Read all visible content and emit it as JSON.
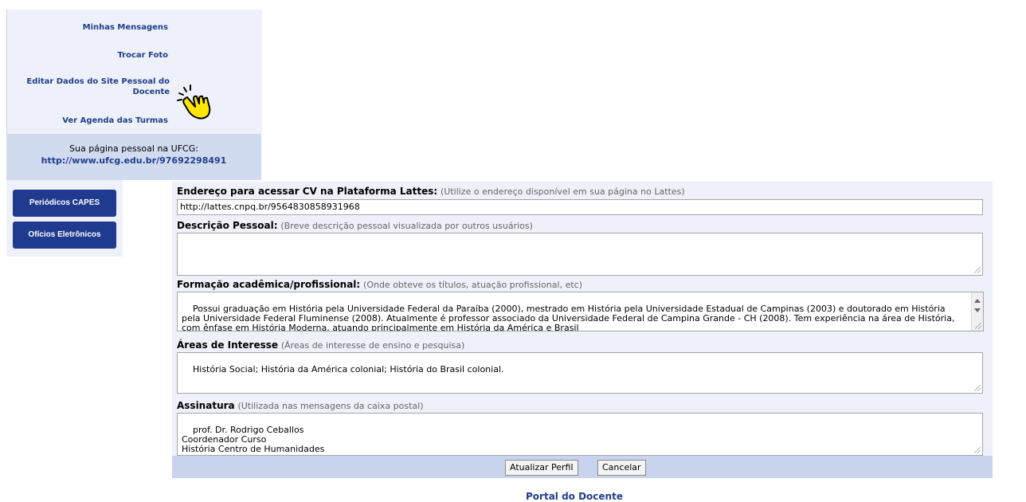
{
  "sidebar": {
    "menu": [
      {
        "label": "Minhas Mensagens"
      },
      {
        "label": "Trocar Foto"
      },
      {
        "label": "Editar Dados do Site Pessoal do Docente"
      },
      {
        "label": "Ver Agenda das Turmas"
      }
    ],
    "personal_page_label": "Sua página pessoal na UFCG:",
    "personal_page_url": "http://www.ufcg.edu.br/97692298491",
    "buttons": [
      {
        "label": "Periódicos CAPES"
      },
      {
        "label": "Ofícios Eletrônicos"
      }
    ],
    "pointer_icon": "pointing-hand-icon"
  },
  "form": {
    "lattes": {
      "label": "Endereço para acessar CV na Plataforma Lattes:",
      "hint": "(Utilize o endereço disponível em sua página no Lattes)",
      "value": "http://lattes.cnpq.br/9564830858931968"
    },
    "descricao": {
      "label": "Descrição Pessoal:",
      "hint": "(Breve descrição pessoal visualizada por outros usuários)",
      "value": ""
    },
    "formacao": {
      "label": "Formação acadêmica/profissional:",
      "hint": "(Onde obteve os títulos, atuação profissional, etc)",
      "value": "Possui graduação em História pela Universidade Federal da Paraíba (2000), mestrado em História pela Universidade Estadual de Campinas (2003) e doutorado em História pela Universidade Federal Fluminense (2008). Atualmente é professor associado da Universidade Federal de Campina Grande - CH (2008). Tem experiência na área de História, com ênfase em História Moderna, atuando principalmente em História da América e Brasil"
    },
    "areas": {
      "label": "Áreas de Interesse",
      "hint": "(Áreas de interesse de ensino e pesquisa)",
      "value": "História Social; História da América colonial; História do Brasil colonial."
    },
    "assinatura": {
      "label": "Assinatura",
      "hint": "(Utilizada nas mensagens da caixa postal)",
      "value": "prof. Dr. Rodrigo Ceballos\nCoordenador Curso\nHistória Centro de Humanidades"
    },
    "update_button": "Atualizar Perfil",
    "cancel_button": "Cancelar"
  },
  "footer": {
    "link": "Portal do Docente"
  },
  "colors": {
    "link": "#1f3f8a",
    "panel_bg": "#eef1fa",
    "bar_bg": "#c8d3ed",
    "button_bg": "#1f3a8f",
    "hand_fill": "#ffe500"
  }
}
